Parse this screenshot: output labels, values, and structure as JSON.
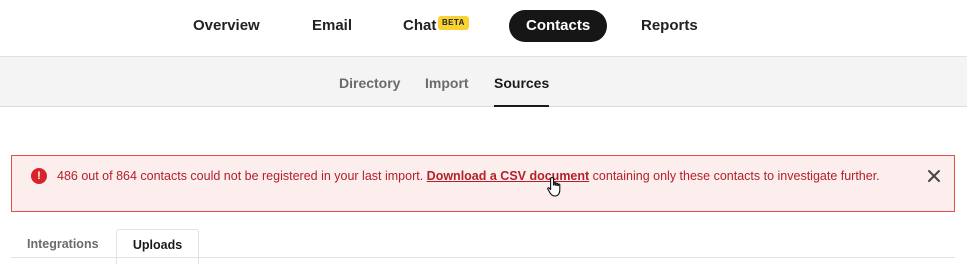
{
  "top_nav": {
    "tabs": [
      {
        "label": "Overview"
      },
      {
        "label": "Email"
      },
      {
        "label": "Chat"
      },
      {
        "label": "Contacts"
      },
      {
        "label": "Reports"
      }
    ],
    "active": "Contacts",
    "chat_badge": "BETA"
  },
  "sub_nav": {
    "tabs": [
      {
        "label": "Directory"
      },
      {
        "label": "Import"
      },
      {
        "label": "Sources"
      }
    ],
    "active": "Sources"
  },
  "alert": {
    "message_before": "486 out of 864 contacts could not be registered in your last import.",
    "link_text": "Download a CSV document",
    "message_after": "containing only these contacts to investigate further.",
    "icon": "error-icon",
    "close_icon": "close-icon"
  },
  "content_tabs": {
    "tabs": [
      {
        "label": "Integrations"
      },
      {
        "label": "Uploads"
      }
    ],
    "active": "Uploads"
  },
  "colors": {
    "nav_active_bg": "#161616",
    "badge_bg": "#f8d232",
    "alert_bg": "#fdeeee",
    "alert_border": "#e04f50",
    "alert_text": "#b3202a"
  }
}
